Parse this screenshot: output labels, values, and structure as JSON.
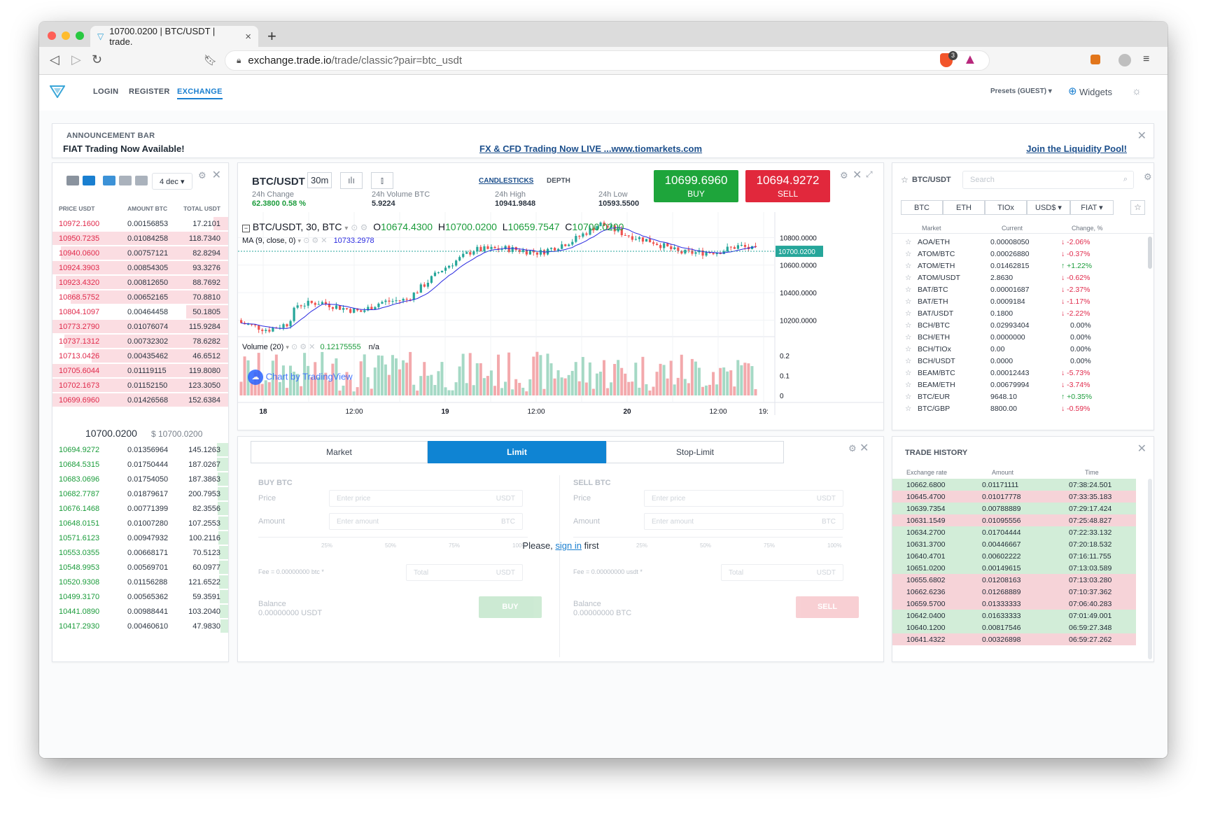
{
  "browser": {
    "tab_title": "10700.0200 | BTC/USDT | trade.",
    "url_host": "exchange.trade.io",
    "url_path": "/trade/classic?pair=btc_usdt",
    "brave_badge": "3"
  },
  "nav": {
    "login": "LOGIN",
    "register": "REGISTER",
    "exchange": "EXCHANGE",
    "presets": "Presets (GUEST) ▾",
    "widgets": "Widgets"
  },
  "announcement": {
    "title": "ANNOUNCEMENT BAR",
    "headline": "FIAT Trading Now Available!",
    "link1": "FX & CFD Trading Now LIVE ...www.tiomarkets.com",
    "link2": "Join the Liquidity Pool!"
  },
  "orderbook": {
    "decimals": "4 dec ▾",
    "headers": {
      "price": "PRICE USDT",
      "amount": "AMOUNT BTC",
      "total": "TOTAL USDT"
    },
    "asks": [
      [
        "10972.1600",
        "0.00156853",
        "17.2101"
      ],
      [
        "10950.7235",
        "0.01084258",
        "118.7340"
      ],
      [
        "10940.0600",
        "0.00757121",
        "82.8294"
      ],
      [
        "10924.3903",
        "0.00854305",
        "93.3276"
      ],
      [
        "10923.4320",
        "0.00812650",
        "88.7692"
      ],
      [
        "10868.5752",
        "0.00652165",
        "70.8810"
      ],
      [
        "10804.1097",
        "0.00464458",
        "50.1805"
      ],
      [
        "10773.2790",
        "0.01076074",
        "115.9284"
      ],
      [
        "10737.1312",
        "0.00732302",
        "78.6282"
      ],
      [
        "10713.0426",
        "0.00435462",
        "46.6512"
      ],
      [
        "10705.6044",
        "0.01119115",
        "119.8080"
      ],
      [
        "10702.1673",
        "0.01152150",
        "123.3050"
      ],
      [
        "10699.6960",
        "0.01426568",
        "152.6384"
      ]
    ],
    "last_price": "10700.0200",
    "last_usd": "$ 10700.0200",
    "bids": [
      [
        "10694.9272",
        "0.01356964",
        "145.1263"
      ],
      [
        "10684.5315",
        "0.01750444",
        "187.0267"
      ],
      [
        "10683.0696",
        "0.01754050",
        "187.3863"
      ],
      [
        "10682.7787",
        "0.01879617",
        "200.7953"
      ],
      [
        "10676.1468",
        "0.00771399",
        "82.3556"
      ],
      [
        "10648.0151",
        "0.01007280",
        "107.2553"
      ],
      [
        "10571.6123",
        "0.00947932",
        "100.2116"
      ],
      [
        "10553.0355",
        "0.00668171",
        "70.5123"
      ],
      [
        "10548.9953",
        "0.00569701",
        "60.0977"
      ],
      [
        "10520.9308",
        "0.01156288",
        "121.6522"
      ],
      [
        "10499.3170",
        "0.00565362",
        "59.3591"
      ],
      [
        "10441.0890",
        "0.00988441",
        "103.2040"
      ],
      [
        "10417.2930",
        "0.00460610",
        "47.9830"
      ]
    ]
  },
  "chart_panel": {
    "pair": "BTC/USDT",
    "interval": "30m",
    "tab_candles": "CANDLESTICKS",
    "tab_depth": "DEPTH",
    "stats": {
      "change_label": "24h Change",
      "change_value": "62.3800 0.58 %",
      "volume_label": "24h Volume BTC",
      "volume_value": "5.9224",
      "high_label": "24h High",
      "high_value": "10941.9848",
      "low_label": "24h Low",
      "low_value": "10593.5500"
    },
    "buy_price": "10699.6960",
    "buy_label": "BUY",
    "sell_price": "10694.9272",
    "sell_label": "SELL",
    "legend_symbol": "BTC/USDT, 30, BTC",
    "ohlc": {
      "o_label": "O",
      "o": "10674.4300",
      "h_label": "H",
      "h": "10700.0200",
      "l_label": "L",
      "l": "10659.7547",
      "c_label": "C",
      "c": "10700.0200"
    },
    "ma_label": "MA (9, close, 0)",
    "ma_value": "10733.2978",
    "volume_label": "Volume (20)",
    "volume_value": "0.12175555",
    "volume_na": "n/a",
    "watermark": "Chart by TradingView",
    "current_price_tag": "10700.0200"
  },
  "chart_data": {
    "type": "candlestick",
    "y_ticks": [
      "10800.0000",
      "10600.0000",
      "10400.0000",
      "10200.0000"
    ],
    "ylim": [
      10070,
      10985
    ],
    "x_ticks": [
      "18",
      "12:00",
      "19",
      "12:00",
      "20",
      "12:00",
      "19:"
    ],
    "volume_ticks": [
      "0.2",
      "0.1",
      "0"
    ],
    "volume_lim": [
      0,
      0.26
    ],
    "current_price": 10700.02
  },
  "markets": {
    "title": "BTC/USDT",
    "search_placeholder": "Search",
    "tabs": [
      "BTC",
      "ETH",
      "TIOx",
      "USD$ ▾",
      "FIAT ▾"
    ],
    "headers": {
      "market": "Market",
      "current": "Current",
      "change": "Change, %"
    },
    "rows": [
      [
        "AOA/ETH",
        "0.00008050",
        "↓ -2.06%",
        "down"
      ],
      [
        "ATOM/BTC",
        "0.00026880",
        "↓ -0.37%",
        "down"
      ],
      [
        "ATOM/ETH",
        "0.01462815",
        "↑ +1.22%",
        "up"
      ],
      [
        "ATOM/USDT",
        "2.8630",
        "↓ -0.62%",
        "down"
      ],
      [
        "BAT/BTC",
        "0.00001687",
        "↓ -2.37%",
        "down"
      ],
      [
        "BAT/ETH",
        "0.0009184",
        "↓ -1.17%",
        "down"
      ],
      [
        "BAT/USDT",
        "0.1800",
        "↓ -2.22%",
        "down"
      ],
      [
        "BCH/BTC",
        "0.02993404",
        "0.00%",
        "flat"
      ],
      [
        "BCH/ETH",
        "0.0000000",
        "0.00%",
        "flat"
      ],
      [
        "BCH/TIOx",
        "0.00",
        "0.00%",
        "flat"
      ],
      [
        "BCH/USDT",
        "0.0000",
        "0.00%",
        "flat"
      ],
      [
        "BEAM/BTC",
        "0.00012443",
        "↓ -5.73%",
        "down"
      ],
      [
        "BEAM/ETH",
        "0.00679994",
        "↓ -3.74%",
        "down"
      ],
      [
        "BTC/EUR",
        "9648.10",
        "↑ +0.35%",
        "up"
      ],
      [
        "BTC/GBP",
        "8800.00",
        "↓ -0.59%",
        "down"
      ]
    ]
  },
  "order_form": {
    "tabs": [
      "Market",
      "Limit",
      "Stop-Limit"
    ],
    "buy_title": "BUY BTC",
    "sell_title": "SELL BTC",
    "price_label": "Price",
    "amount_label": "Amount",
    "price_placeholder": "Enter price",
    "amount_placeholder": "Enter amount",
    "total_placeholder": "Total",
    "unit_usdt": "USDT",
    "unit_btc": "BTC",
    "fee_buy": "Fee = 0.00000000 btc *",
    "fee_sell": "Fee = 0.00000000 usdt *",
    "balance_label": "Balance",
    "balance_buy": "0.00000000 USDT",
    "balance_sell": "0.00000000 BTC",
    "buy_button": "BUY",
    "sell_button": "SELL",
    "pct": [
      "25%",
      "50%",
      "75%",
      "100%"
    ],
    "signin_before": "Please,",
    "signin_link": "sign in",
    "signin_after": "first"
  },
  "trade_history": {
    "title": "TRADE HISTORY",
    "headers": {
      "rate": "Exchange rate",
      "amount": "Amount",
      "time": "Time"
    },
    "rows": [
      [
        "10662.6800",
        "0.01171111",
        "07:38:24.501",
        "buy"
      ],
      [
        "10645.4700",
        "0.01017778",
        "07:33:35.183",
        "sell"
      ],
      [
        "10639.7354",
        "0.00788889",
        "07:29:17.424",
        "buy"
      ],
      [
        "10631.1549",
        "0.01095556",
        "07:25:48.827",
        "sell"
      ],
      [
        "10634.2700",
        "0.01704444",
        "07:22:33.132",
        "buy"
      ],
      [
        "10631.3700",
        "0.00446667",
        "07:20:18.532",
        "buy"
      ],
      [
        "10640.4701",
        "0.00602222",
        "07:16:11.755",
        "buy"
      ],
      [
        "10651.0200",
        "0.00149615",
        "07:13:03.589",
        "buy"
      ],
      [
        "10655.6802",
        "0.01208163",
        "07:13:03.280",
        "sell"
      ],
      [
        "10662.6236",
        "0.01268889",
        "07:10:37.362",
        "sell"
      ],
      [
        "10659.5700",
        "0.01333333",
        "07:06:40.283",
        "sell"
      ],
      [
        "10642.0400",
        "0.01633333",
        "07:01:49.001",
        "buy"
      ],
      [
        "10640.1200",
        "0.00817546",
        "06:59:27.348",
        "buy"
      ],
      [
        "10641.4322",
        "0.00326898",
        "06:59:27.262",
        "sell"
      ]
    ]
  },
  "colors": {
    "accent": "#1a7fd0",
    "up": "#1b9c3b",
    "down": "#e0284a",
    "buy_bg": "#1ea53b",
    "sell_bg": "#e1283c"
  }
}
